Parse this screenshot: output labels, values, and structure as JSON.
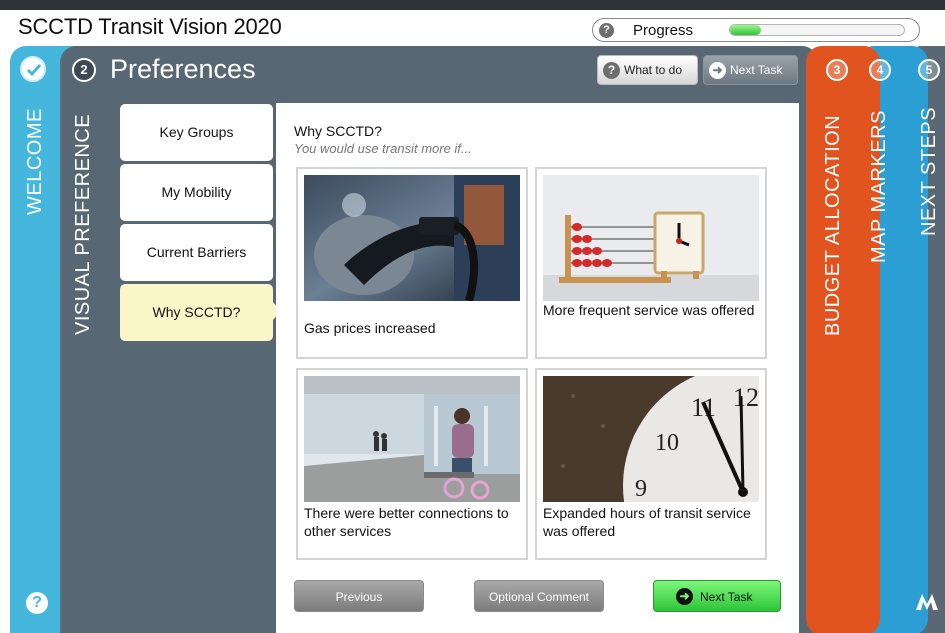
{
  "app": {
    "title": "SCCTD Transit Vision 2020"
  },
  "progress": {
    "label": "Progress",
    "help_icon": "?",
    "value_fraction": 0.18
  },
  "tabs": [
    {
      "step": "",
      "label": "WELCOME",
      "icon": "check-icon",
      "color": "#45b7dc"
    },
    {
      "step": "2",
      "label": "VISUAL PREFERENCE",
      "color": "#5f6e7b"
    },
    {
      "step": "3",
      "label": "BUDGET ALLOCATION",
      "color": "#e1531f"
    },
    {
      "step": "4",
      "label": "MAP MARKERS",
      "color": "#2b9fd4"
    },
    {
      "step": "5",
      "label": "NEXT STEPS",
      "color": "#596874"
    }
  ],
  "header": {
    "step": "2",
    "title": "Preferences",
    "what_to_do": "What to do",
    "what_to_do_icon": "?",
    "next_task": "Next Task"
  },
  "sidebar": {
    "items": [
      {
        "label": "Key Groups",
        "active": false
      },
      {
        "label": "My Mobility",
        "active": false
      },
      {
        "label": "Current Barriers",
        "active": false
      },
      {
        "label": "Why SCCTD?",
        "active": true
      }
    ]
  },
  "question": {
    "title": "Why SCCTD?",
    "subtitle": "You would use transit more if..."
  },
  "options": [
    {
      "label": "Gas prices increased",
      "image": "gas-pump-photo"
    },
    {
      "label": "More frequent service was offered",
      "image": "abacus-clock-photo"
    },
    {
      "label": "There were better connections to other services",
      "image": "transit-platform-photo"
    },
    {
      "label": "Expanded hours of transit service was offered",
      "image": "clock-face-photo"
    }
  ],
  "footer": {
    "previous": "Previous",
    "optional_comment": "Optional Comment",
    "next_task": "Next Task"
  },
  "colors": {
    "accent_green": "#2ec438",
    "panel": "#586774",
    "active_item": "#fbf6c8"
  },
  "help_icon": "?",
  "logo": "metroquest-logo"
}
